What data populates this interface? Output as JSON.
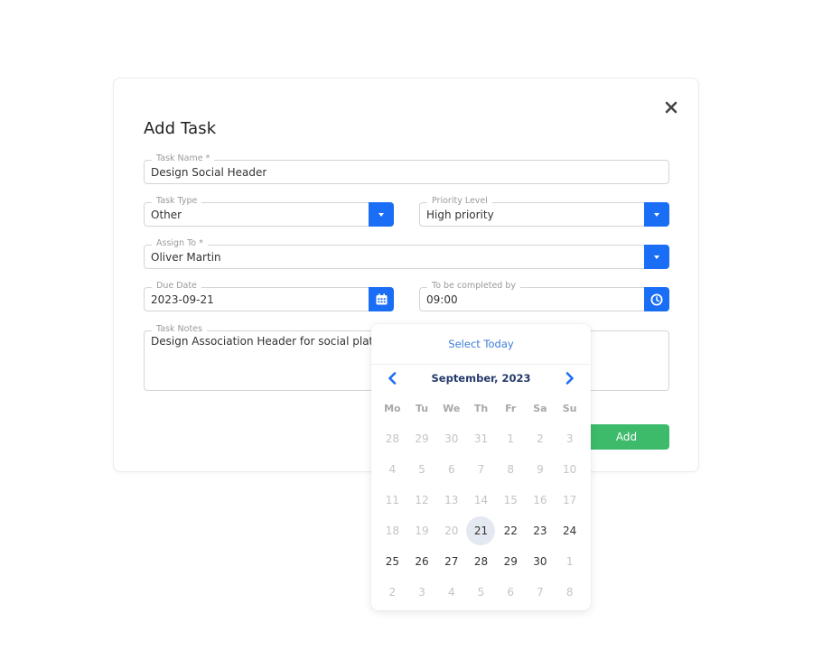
{
  "modal": {
    "title": "Add Task",
    "close_icon": "close-icon",
    "fields": {
      "task_name": {
        "label": "Task Name *",
        "value": "Design Social Header"
      },
      "task_type": {
        "label": "Task Type",
        "value": "Other",
        "icon": "chevron-down-icon"
      },
      "priority_level": {
        "label": "Priority Level",
        "value": "High priority",
        "icon": "chevron-down-icon"
      },
      "assign_to": {
        "label": "Assign To *",
        "value": "Oliver Martin",
        "icon": "chevron-down-icon"
      },
      "due_date": {
        "label": "Due Date",
        "value": "2023-09-21",
        "icon": "calendar-icon"
      },
      "completed_by": {
        "label": "To be completed by",
        "value": "09:00",
        "icon": "clock-icon"
      },
      "task_notes": {
        "label": "Task Notes",
        "value": "Design Association Header for social platfor"
      }
    },
    "add_button": "Add"
  },
  "datepicker": {
    "select_today": "Select Today",
    "month_label": "September, 2023",
    "prev_icon": "chevron-left-icon",
    "next_icon": "chevron-right-icon",
    "weekdays": [
      "Mo",
      "Tu",
      "We",
      "Th",
      "Fr",
      "Sa",
      "Su"
    ],
    "selected_day": "21",
    "weeks": [
      [
        {
          "d": "28",
          "active": false
        },
        {
          "d": "29",
          "active": false
        },
        {
          "d": "30",
          "active": false
        },
        {
          "d": "31",
          "active": false
        },
        {
          "d": "1",
          "active": false
        },
        {
          "d": "2",
          "active": false
        },
        {
          "d": "3",
          "active": false
        }
      ],
      [
        {
          "d": "4",
          "active": false
        },
        {
          "d": "5",
          "active": false
        },
        {
          "d": "6",
          "active": false
        },
        {
          "d": "7",
          "active": false
        },
        {
          "d": "8",
          "active": false
        },
        {
          "d": "9",
          "active": false
        },
        {
          "d": "10",
          "active": false
        }
      ],
      [
        {
          "d": "11",
          "active": false
        },
        {
          "d": "12",
          "active": false
        },
        {
          "d": "13",
          "active": false
        },
        {
          "d": "14",
          "active": false
        },
        {
          "d": "15",
          "active": false
        },
        {
          "d": "16",
          "active": false
        },
        {
          "d": "17",
          "active": false
        }
      ],
      [
        {
          "d": "18",
          "active": false
        },
        {
          "d": "19",
          "active": false
        },
        {
          "d": "20",
          "active": false
        },
        {
          "d": "21",
          "active": true,
          "selected": true
        },
        {
          "d": "22",
          "active": true
        },
        {
          "d": "23",
          "active": true
        },
        {
          "d": "24",
          "active": true
        }
      ],
      [
        {
          "d": "25",
          "active": true
        },
        {
          "d": "26",
          "active": true
        },
        {
          "d": "27",
          "active": true
        },
        {
          "d": "28",
          "active": true
        },
        {
          "d": "29",
          "active": true
        },
        {
          "d": "30",
          "active": true
        },
        {
          "d": "1",
          "active": false
        }
      ],
      [
        {
          "d": "2",
          "active": false
        },
        {
          "d": "3",
          "active": false
        },
        {
          "d": "4",
          "active": false
        },
        {
          "d": "5",
          "active": false
        },
        {
          "d": "6",
          "active": false
        },
        {
          "d": "7",
          "active": false
        },
        {
          "d": "8",
          "active": false
        }
      ]
    ]
  }
}
